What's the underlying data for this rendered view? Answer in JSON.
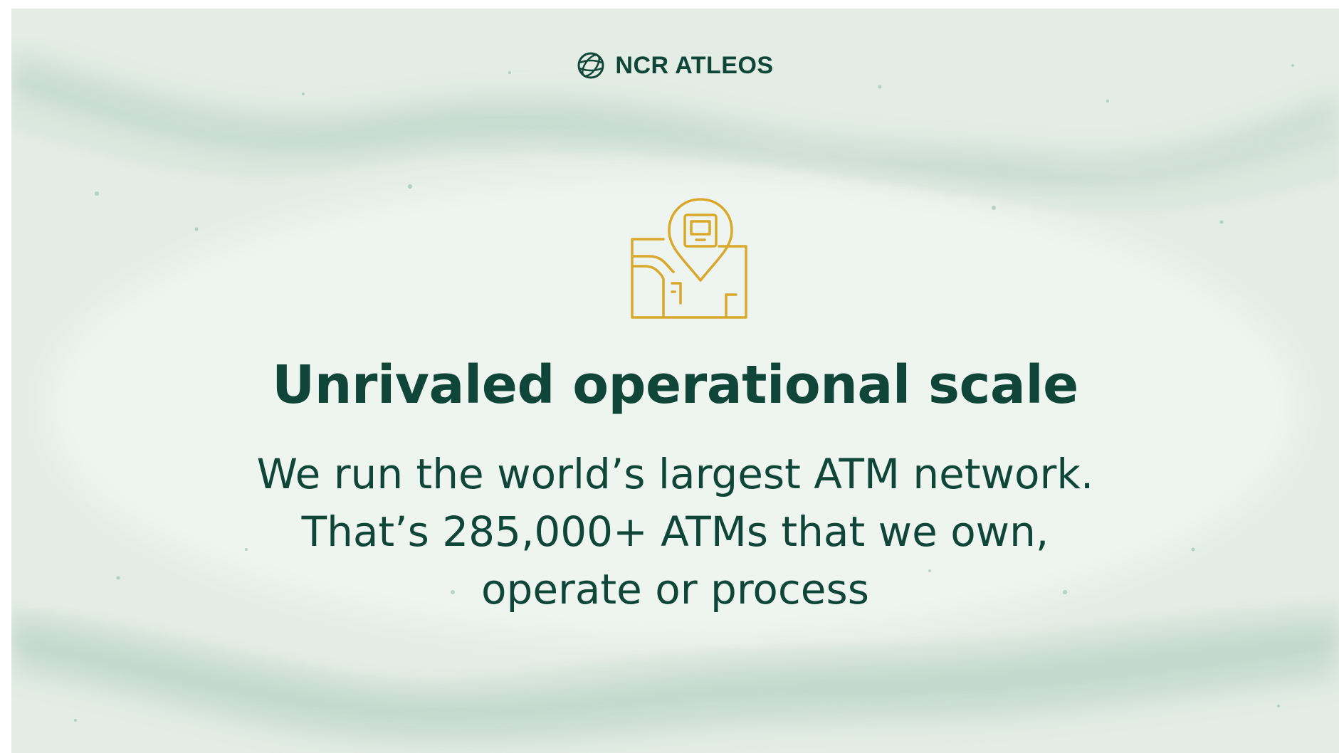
{
  "brand": {
    "name": "NCR ATLEOS",
    "icon": "globe-icon",
    "color": "#0f4637"
  },
  "hero": {
    "icon": "atm-location-pin-map-icon",
    "icon_color": "#d9a82b"
  },
  "headline": "Unrivaled operational scale",
  "body": {
    "lines": [
      "We run the world’s largest ATM network.",
      "That’s 285,000+ ATMs that we own,",
      "operate or process"
    ]
  },
  "colors": {
    "background": "#e3ede5",
    "wave": "#7aa896",
    "text": "#0f4637",
    "accent": "#d9a82b"
  }
}
